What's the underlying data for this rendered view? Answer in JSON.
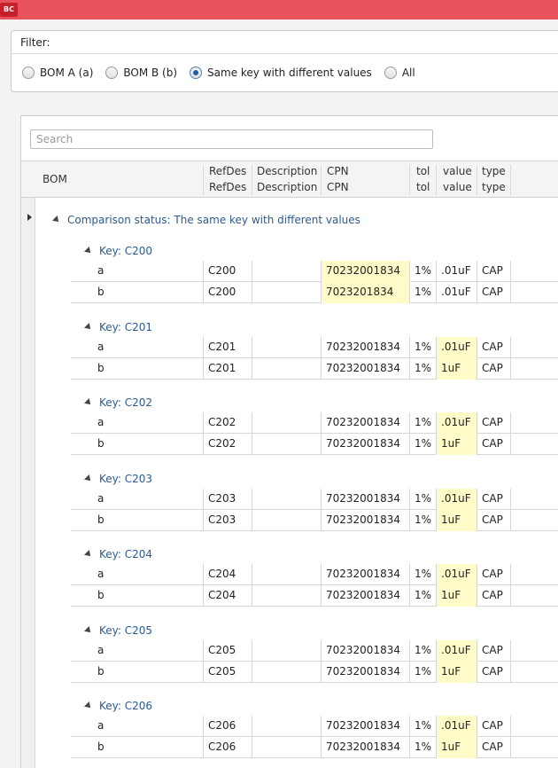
{
  "app": {
    "icon_label": "BC"
  },
  "filter": {
    "title": "Filter:",
    "options": [
      {
        "label": "BOM A (a)",
        "selected": false
      },
      {
        "label": "BOM B (b)",
        "selected": false
      },
      {
        "label": "Same key with different values",
        "selected": true
      },
      {
        "label": "All",
        "selected": false
      }
    ]
  },
  "grid": {
    "search_placeholder": "Search",
    "columns": {
      "bom": "BOM",
      "refdes": [
        "RefDes",
        "RefDes"
      ],
      "description": [
        "Description",
        "Description"
      ],
      "cpn": [
        "CPN",
        "CPN"
      ],
      "tol": [
        "tol",
        "tol"
      ],
      "value": [
        "value",
        "value"
      ],
      "type": [
        "type",
        "type"
      ]
    },
    "group_status": "Comparison status: The same key with different values",
    "keys": [
      {
        "label": "Key: C200",
        "rows": [
          {
            "bom": "a",
            "refdes": "C200",
            "description": "",
            "cpn": "70232001834",
            "tol": "1%",
            "value": ".01uF",
            "type": "CAP"
          },
          {
            "bom": "b",
            "refdes": "C200",
            "description": "",
            "cpn": "7023201834",
            "tol": "1%",
            "value": ".01uF",
            "type": "CAP"
          }
        ],
        "highlight": "cpn"
      },
      {
        "label": "Key: C201",
        "rows": [
          {
            "bom": "a",
            "refdes": "C201",
            "description": "",
            "cpn": "70232001834",
            "tol": "1%",
            "value": ".01uF",
            "type": "CAP"
          },
          {
            "bom": "b",
            "refdes": "C201",
            "description": "",
            "cpn": "70232001834",
            "tol": "1%",
            "value": "1uF",
            "type": "CAP"
          }
        ],
        "highlight": "value"
      },
      {
        "label": "Key: C202",
        "rows": [
          {
            "bom": "a",
            "refdes": "C202",
            "description": "",
            "cpn": "70232001834",
            "tol": "1%",
            "value": ".01uF",
            "type": "CAP"
          },
          {
            "bom": "b",
            "refdes": "C202",
            "description": "",
            "cpn": "70232001834",
            "tol": "1%",
            "value": "1uF",
            "type": "CAP"
          }
        ],
        "highlight": "value"
      },
      {
        "label": "Key: C203",
        "rows": [
          {
            "bom": "a",
            "refdes": "C203",
            "description": "",
            "cpn": "70232001834",
            "tol": "1%",
            "value": ".01uF",
            "type": "CAP"
          },
          {
            "bom": "b",
            "refdes": "C203",
            "description": "",
            "cpn": "70232001834",
            "tol": "1%",
            "value": "1uF",
            "type": "CAP"
          }
        ],
        "highlight": "value"
      },
      {
        "label": "Key: C204",
        "rows": [
          {
            "bom": "a",
            "refdes": "C204",
            "description": "",
            "cpn": "70232001834",
            "tol": "1%",
            "value": ".01uF",
            "type": "CAP"
          },
          {
            "bom": "b",
            "refdes": "C204",
            "description": "",
            "cpn": "70232001834",
            "tol": "1%",
            "value": "1uF",
            "type": "CAP"
          }
        ],
        "highlight": "value"
      },
      {
        "label": "Key: C205",
        "rows": [
          {
            "bom": "a",
            "refdes": "C205",
            "description": "",
            "cpn": "70232001834",
            "tol": "1%",
            "value": ".01uF",
            "type": "CAP"
          },
          {
            "bom": "b",
            "refdes": "C205",
            "description": "",
            "cpn": "70232001834",
            "tol": "1%",
            "value": "1uF",
            "type": "CAP"
          }
        ],
        "highlight": "value"
      },
      {
        "label": "Key: C206",
        "rows": [
          {
            "bom": "a",
            "refdes": "C206",
            "description": "",
            "cpn": "70232001834",
            "tol": "1%",
            "value": ".01uF",
            "type": "CAP"
          },
          {
            "bom": "b",
            "refdes": "C206",
            "description": "",
            "cpn": "70232001834",
            "tol": "1%",
            "value": "1uF",
            "type": "CAP"
          }
        ],
        "highlight": "value"
      }
    ]
  }
}
